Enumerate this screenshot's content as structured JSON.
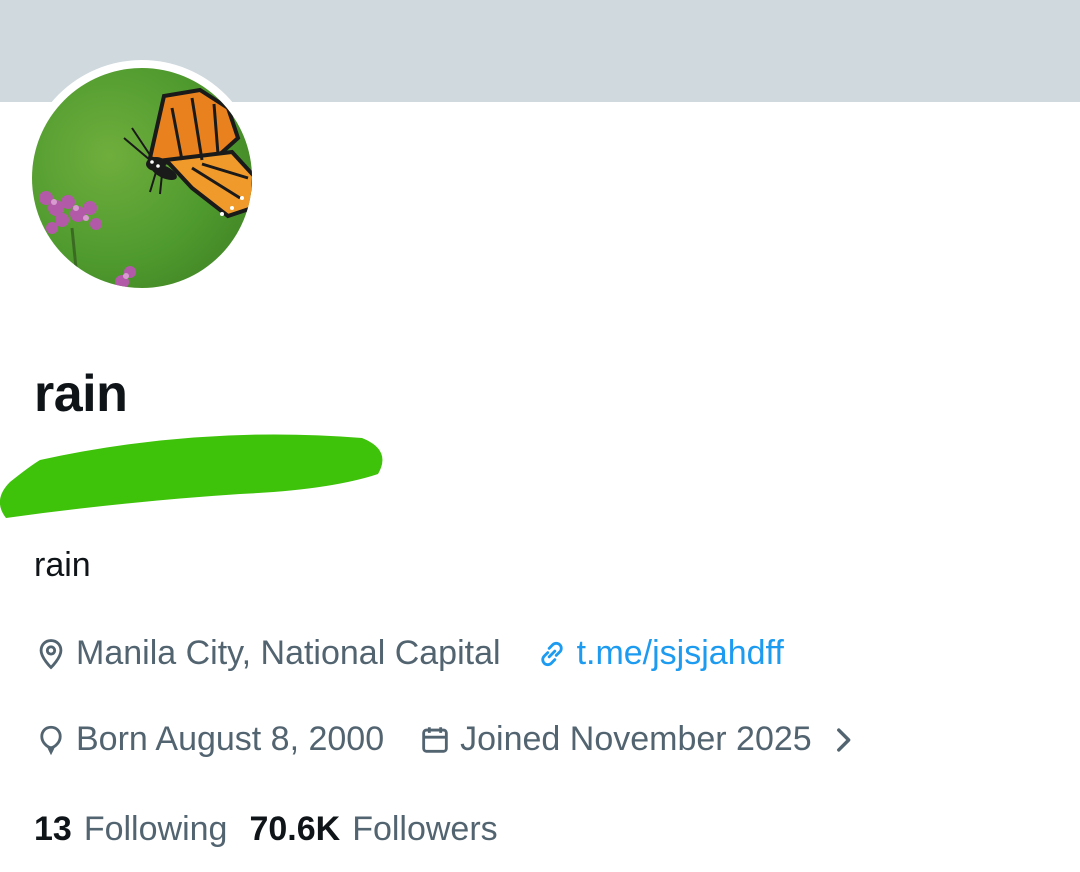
{
  "profile": {
    "display_name": "rain",
    "handle": "",
    "bio": "rain",
    "location": "Manila City, National Capital",
    "website": "t.me/jsjsjahdff",
    "birthday": "Born August 8, 2000",
    "joined": "Joined November 2025",
    "following_count": "13",
    "following_label": "Following",
    "followers_count": "70.6K",
    "followers_label": "Followers"
  },
  "icons": {
    "location": "location-pin-icon",
    "website": "link-icon",
    "birthday": "balloon-icon",
    "joined": "calendar-icon",
    "expand": "chevron-right-icon"
  },
  "colors": {
    "banner": "#cfd9de",
    "text_primary": "#0f1419",
    "text_secondary": "#536471",
    "link": "#1d9bf0",
    "redaction": "#3ec20a"
  }
}
